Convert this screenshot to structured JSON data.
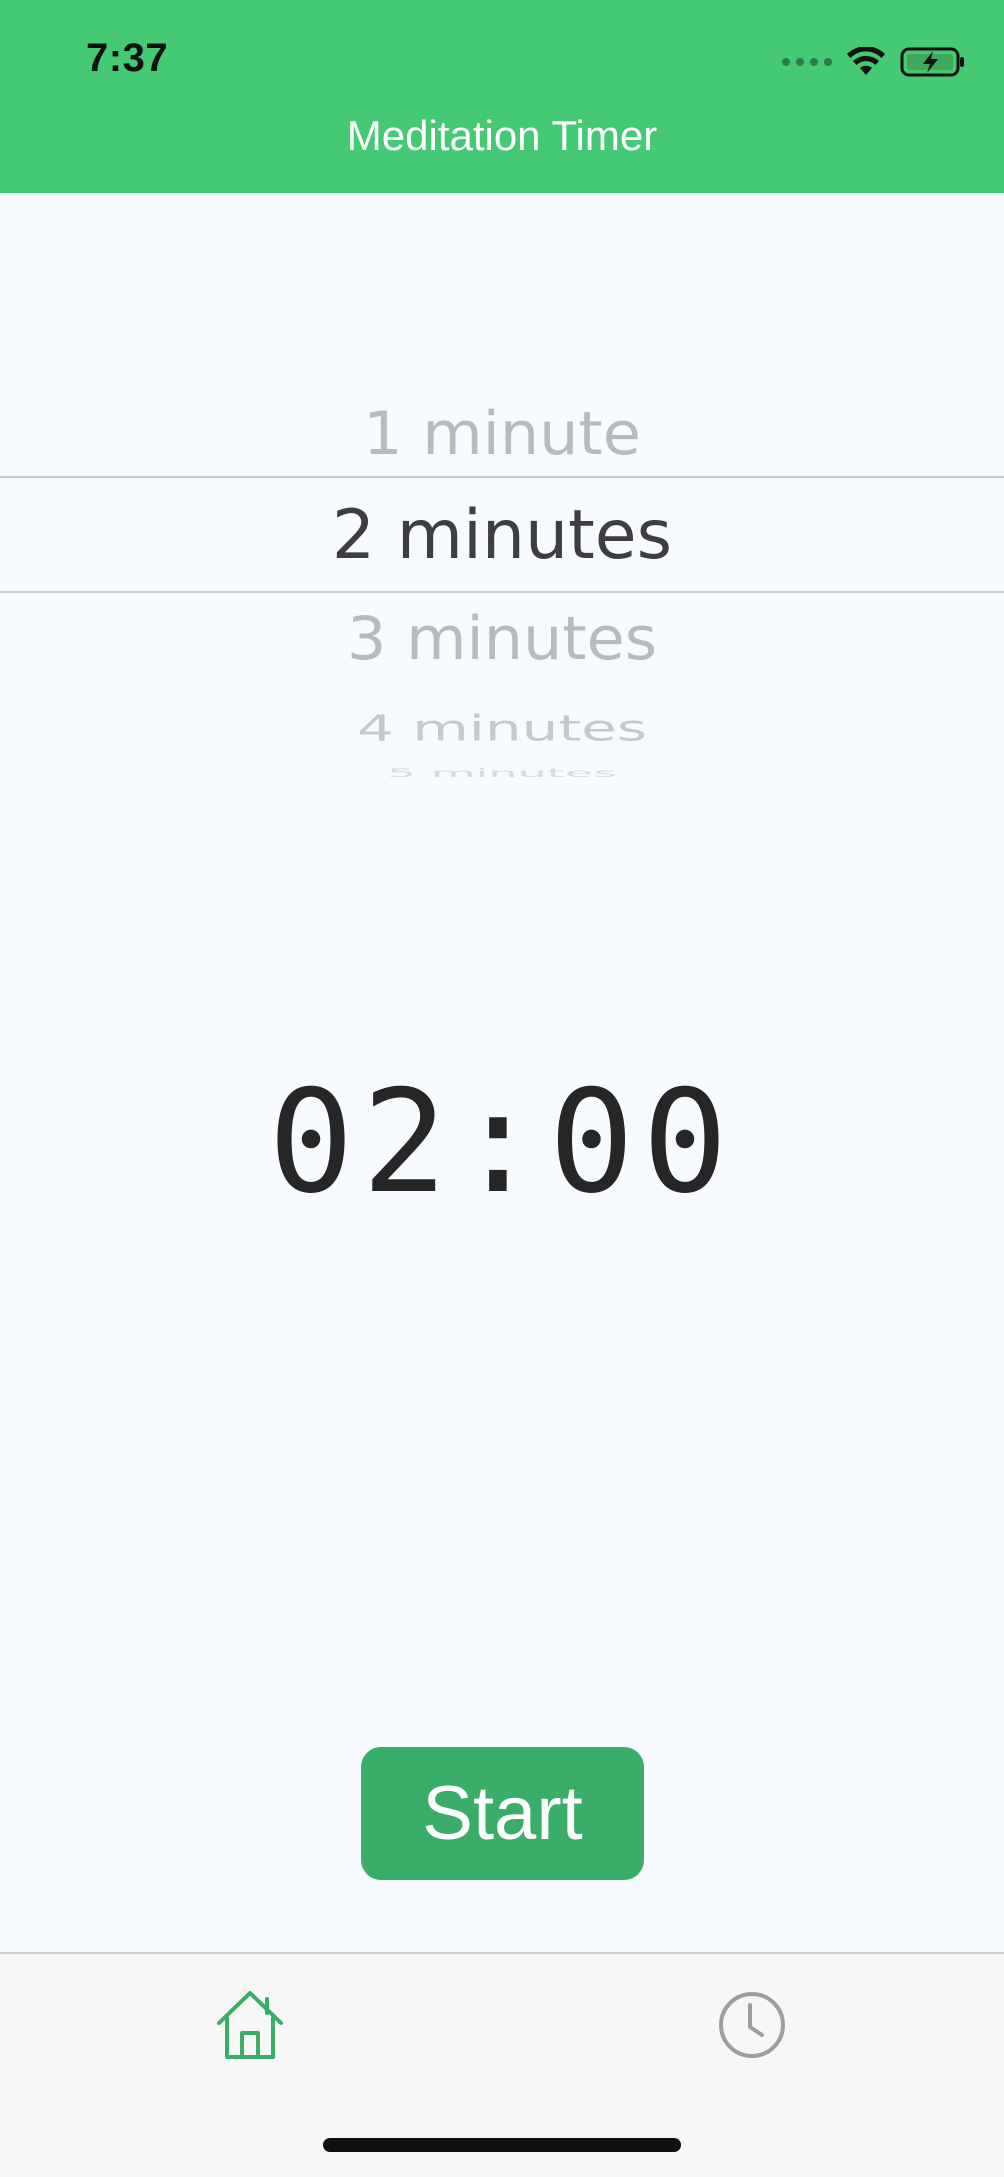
{
  "status_bar": {
    "time": "7:37"
  },
  "header": {
    "title": "Meditation Timer",
    "background_color": "#45C974"
  },
  "picker": {
    "options": [
      "1 minute",
      "2 minutes",
      "3 minutes",
      "4 minutes",
      "5 minutes"
    ],
    "selected": "2 minutes"
  },
  "timer": {
    "display": "02:00"
  },
  "actions": {
    "start_label": "Start",
    "button_color": "#3AAE68"
  },
  "tab_bar": {
    "tabs": [
      {
        "icon": "home-icon",
        "active": true,
        "color": "#3AAE68"
      },
      {
        "icon": "clock-icon",
        "active": false,
        "color": "#9E9E9E"
      }
    ]
  }
}
